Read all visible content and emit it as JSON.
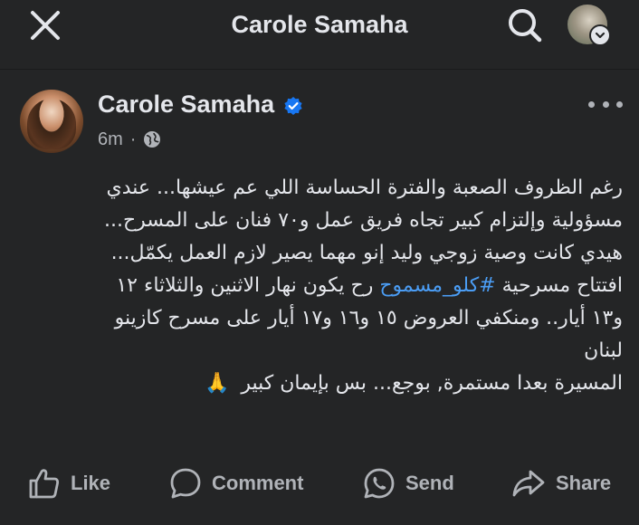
{
  "header": {
    "title": "Carole Samaha",
    "close_icon": "close-icon",
    "search_icon": "search-icon"
  },
  "post": {
    "author": "Carole Samaha",
    "verified": true,
    "time": "6m",
    "separator": "·",
    "audience_icon": "globe-icon",
    "text_lines": [
      "رغم الظروف الصعبة والفترة الحساسة اللي عم عيشها... عندي",
      "مسؤولية وإلتزام كبير تجاه فريق عمل و٧٠ فنان على المسرح...",
      "هيدي كانت وصية زوجي وليد إنو مهما يصير لازم العمل يكمّل...",
      "لبنان",
      "المسيرة بعدا مستمرة, بوجع... بس بإيمان كبير"
    ],
    "line4_before": "افتتاح مسرحية ",
    "hashtag": "#كلو_مسموح",
    "line4_after": " رح يكون نهار الاثنين والثلاثاء ١٢",
    "line5": "و١٣ أيار.. ومنكفي العروض ١٥ و١٦ و١٧ أيار على مسرح كازينو",
    "emoji": "🙏"
  },
  "actions": {
    "like": "Like",
    "comment": "Comment",
    "send": "Send",
    "share": "Share"
  },
  "colors": {
    "background": "#242526",
    "text": "#e4e6eb",
    "secondary": "#b0b3b8",
    "link": "#4b9df4",
    "verified": "#1877f2"
  }
}
